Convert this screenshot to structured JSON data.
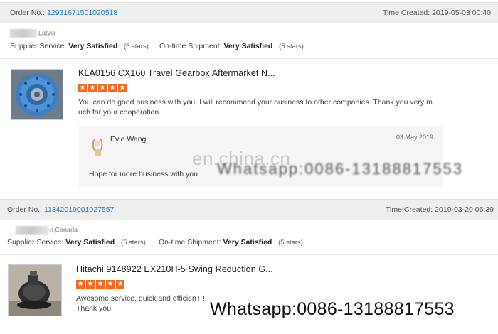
{
  "orders": [
    {
      "order_label": "Order No.:",
      "order_number": "12931671501020518",
      "time_label": "Time Created:",
      "time_value": "2019-05-03 00:40",
      "buyer_country": "Latvia",
      "supplier_service_label": "Supplier Service:",
      "supplier_service_value": "Very Satisfied",
      "supplier_service_stars": "(5 stars)",
      "shipment_label": "On-time Shipment:",
      "shipment_value": "Very Satisfied",
      "shipment_stars": "(5 stars)",
      "product_title": "KLA0156 CX160 Travel Gearbox Aftermarket N...",
      "rating": 5,
      "review_line1": "You can do good business with you. I will recommend your business to other companies. Thank you very m",
      "review_line2": "uch for your cooperation.",
      "reply_name": "Evie Wang",
      "reply_date": "03 May 2019",
      "reply_text": "Hope for more business with you ."
    },
    {
      "order_label": "Order No.:",
      "order_number": "11342019001027557",
      "time_label": "Time Created:",
      "time_value": "2019-03-20 06:39",
      "buyer_country": "e,Canada",
      "supplier_service_label": "Supplier Service:",
      "supplier_service_value": "Very Satisfied",
      "supplier_service_stars": "(5 stars)",
      "shipment_label": "On-time Shipment:",
      "shipment_value": "Very Satisfied",
      "shipment_stars": "(5 stars)",
      "product_title": "Hitachi 9148922 EX210H-5 Swing Reduction G...",
      "rating": 5,
      "review_line1": "Awesome service, quick and efficienT !",
      "review_line2": "Thank you"
    }
  ],
  "watermarks": {
    "site": "en.china.cn",
    "whatsapp": "Whatsapp:0086-13188817553"
  },
  "colors": {
    "link": "#1f7fc4",
    "star": "#f16a1d"
  }
}
